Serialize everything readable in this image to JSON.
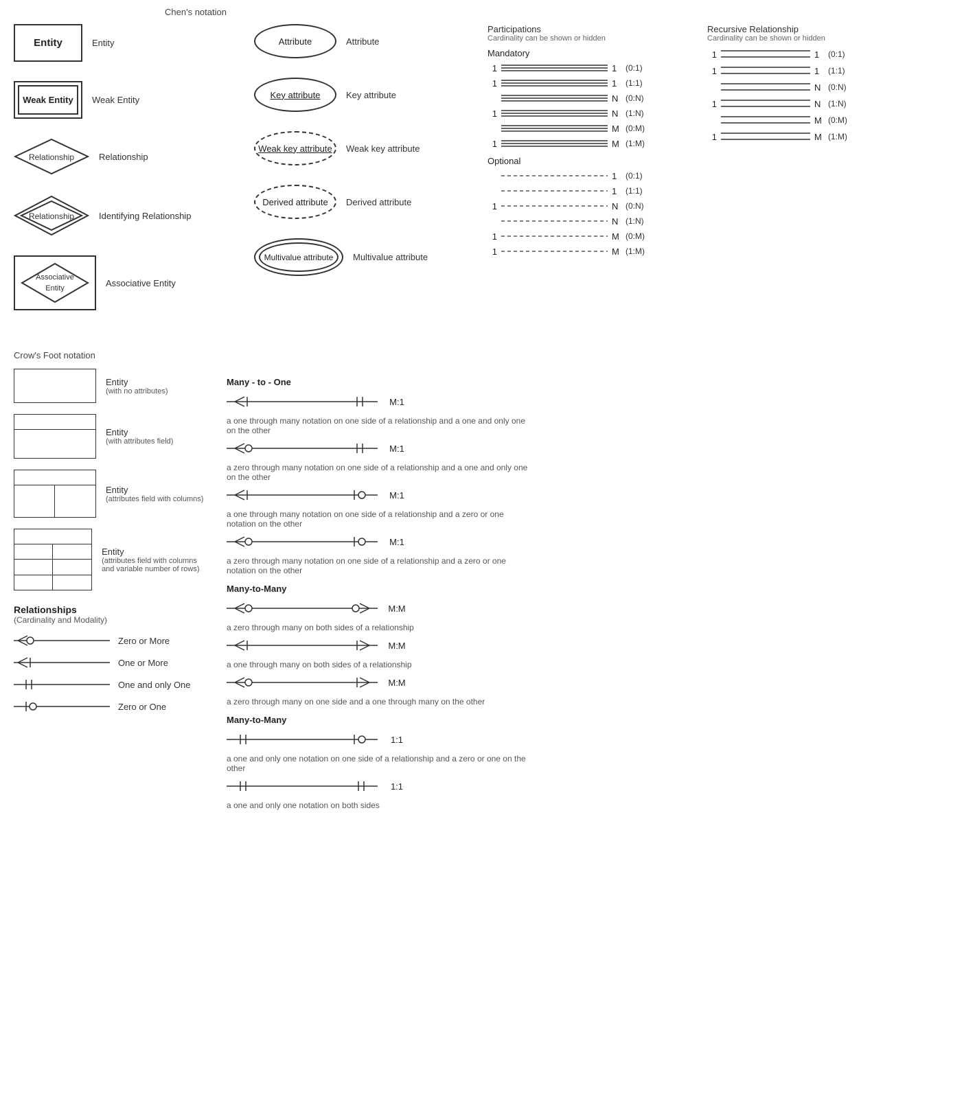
{
  "chens": {
    "header": "Chen's notation",
    "entities": [
      {
        "shape": "entity",
        "text": "Entity",
        "label": "Entity"
      },
      {
        "shape": "weak-entity",
        "text": "Weak Entity",
        "label": "Weak Entity"
      },
      {
        "shape": "diamond",
        "text": "Relationship",
        "label": "Relationship"
      },
      {
        "shape": "diamond-double",
        "text": "Relationship",
        "label": "Identifying Relationship"
      },
      {
        "shape": "assoc-entity",
        "text": "Associative Entity",
        "label": "Associative Entity"
      }
    ],
    "attributes": [
      {
        "shape": "ellipse",
        "text": "Attribute",
        "label": "Attribute"
      },
      {
        "shape": "ellipse-key",
        "text": "Key attribute",
        "label": "Key attribute"
      },
      {
        "shape": "ellipse-weak-key",
        "text": "Weak key attribute",
        "label": "Weak key attribute"
      },
      {
        "shape": "ellipse-derived",
        "text": "Derived attribute",
        "label": "Derived attribute"
      },
      {
        "shape": "ellipse-multivalue",
        "text": "Multivalue attribute",
        "label": "Multivalue attribute"
      }
    ]
  },
  "participations": {
    "header": "Participations",
    "subheader": "Cardinality can be shown or hidden",
    "mandatory_label": "Mandatory",
    "optional_label": "Optional",
    "mandatory_rows": [
      {
        "left": "1",
        "right": "1",
        "notation": "(0:1)"
      },
      {
        "left": "1",
        "right": "1",
        "notation": "(1:1)"
      },
      {
        "left": "",
        "right": "N",
        "notation": "(0:N)"
      },
      {
        "left": "1",
        "right": "N",
        "notation": "(1:N)"
      },
      {
        "left": "",
        "right": "M",
        "notation": "(0:M)"
      },
      {
        "left": "1",
        "right": "M",
        "notation": "(1:M)"
      }
    ],
    "optional_rows": [
      {
        "left": "",
        "right": "1",
        "notation": "(0:1)",
        "dashed": true
      },
      {
        "left": "",
        "right": "1",
        "notation": "(1:1)",
        "dashed": true
      },
      {
        "left": "1",
        "right": "N",
        "notation": "(0:N)",
        "dashed": true
      },
      {
        "left": "",
        "right": "N",
        "notation": "(1:N)",
        "dashed": true
      },
      {
        "left": "1",
        "right": "M",
        "notation": "(0:M)",
        "dashed": true
      },
      {
        "left": "1",
        "right": "M",
        "notation": "(1:M)",
        "dashed": true
      }
    ]
  },
  "recursive": {
    "header": "Recursive Relationship",
    "subheader": "Cardinality can be shown or hidden",
    "rows": [
      {
        "left": "1",
        "right": "1",
        "notation": "(0:1)"
      },
      {
        "left": "1",
        "right": "1",
        "notation": "(1:1)"
      },
      {
        "left": "",
        "right": "N",
        "notation": "(0:N)"
      },
      {
        "left": "1",
        "right": "N",
        "notation": "(1:N)"
      },
      {
        "left": "",
        "right": "M",
        "notation": "(0:M)"
      },
      {
        "left": "1",
        "right": "M",
        "notation": "(1:M)"
      }
    ]
  },
  "crowsfoot": {
    "header": "Crow's Foot notation",
    "entities": [
      {
        "type": "simple",
        "label": "Entity",
        "sublabel": "(with no attributes)"
      },
      {
        "type": "attrs",
        "label": "Entity",
        "sublabel": "(with attributes field)"
      },
      {
        "type": "cols",
        "label": "Entity",
        "sublabel": "(attributes field with columns)"
      },
      {
        "type": "varrows",
        "label": "Entity",
        "sublabel": "(attributes field with columns and variable number of rows)"
      }
    ],
    "many_to_one_label": "Many - to - One",
    "many_to_one_rows": [
      {
        "ratio": "M:1",
        "left_type": "crow-one",
        "right_type": "one-only",
        "desc": "a one through many notation on one side of a relationship and a one and only one on the other"
      },
      {
        "ratio": "M:1",
        "left_type": "crow-zero",
        "right_type": "one-only",
        "desc": "a zero through many notation on one side of a relationship and a one and only one on the other"
      },
      {
        "ratio": "M:1",
        "left_type": "crow-one",
        "right_type": "zero-one",
        "desc": "a one through many notation on one side of a relationship and a zero or one notation on the other"
      },
      {
        "ratio": "M:1",
        "left_type": "crow-zero",
        "right_type": "zero-one",
        "desc": "a zero through many notation on one side of a relationship and a zero or one notation on the other"
      }
    ],
    "many_to_many_label": "Many-to-Many",
    "many_to_many_rows": [
      {
        "ratio": "M:M",
        "left_type": "crow-zero",
        "right_type": "crow-zero-r",
        "desc": "a zero through many on both sides of a relationship"
      },
      {
        "ratio": "M:M",
        "left_type": "crow-one",
        "right_type": "crow-one-r",
        "desc": "a one through many on both sides of a relationship"
      },
      {
        "ratio": "M:M",
        "left_type": "crow-zero",
        "right_type": "crow-one-r",
        "desc": "a zero through many on one side and a one through many on the other"
      }
    ],
    "one_to_one_label": "Many-to-Many",
    "one_to_one_rows": [
      {
        "ratio": "1:1",
        "left_type": "one-only",
        "right_type": "zero-one",
        "desc": "a one and only one notation on one side of a relationship and a zero or one on the other"
      },
      {
        "ratio": "1:1",
        "left_type": "one-only",
        "right_type": "one-only-r",
        "desc": "a one and only one notation on both sides"
      }
    ],
    "relationships_label": "Relationships",
    "relationships_sub": "(Cardinality and Modality)",
    "rel_rows": [
      {
        "type": "zero-more",
        "label": "Zero or More"
      },
      {
        "type": "one-more",
        "label": "One or More"
      },
      {
        "type": "one-only",
        "label": "One and only One"
      },
      {
        "type": "zero-one",
        "label": "Zero or One"
      }
    ]
  }
}
